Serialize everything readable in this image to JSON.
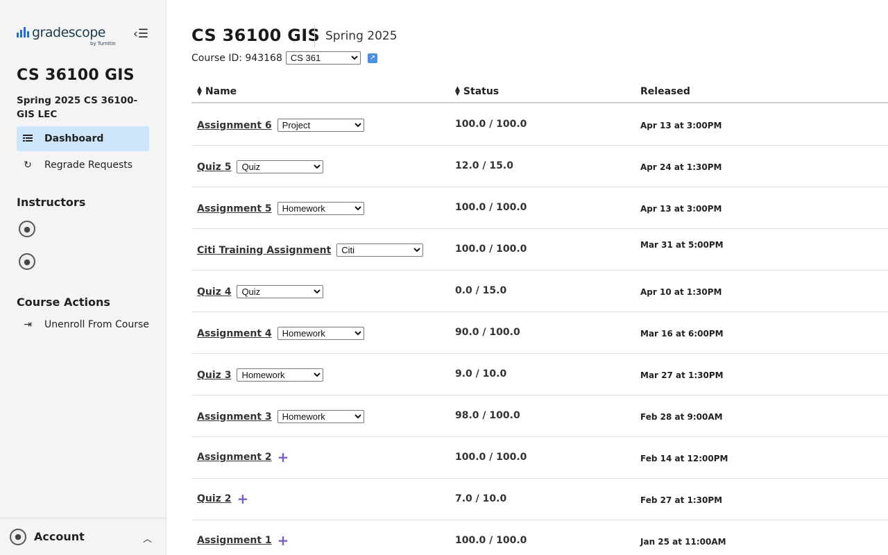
{
  "sidebar": {
    "logo_text": "gradescope",
    "logo_sub": "by Turnitin",
    "course_title": "CS 36100 GIS",
    "course_term": "Spring 2025 CS 36100-GIS LEC",
    "nav": [
      {
        "label": "Dashboard",
        "icon": "dashboard-icon",
        "active": true
      },
      {
        "label": "Regrade Requests",
        "icon": "refresh-icon",
        "active": false
      }
    ],
    "instructors_heading": "Instructors",
    "course_actions_heading": "Course Actions",
    "unenroll_label": "Unenroll From Course",
    "account_label": "Account"
  },
  "header": {
    "title": "CS 36100 GIS",
    "term": "Spring 2025",
    "course_id_label": "Course ID: 943168",
    "course_select_value": "CS 361"
  },
  "table": {
    "columns": [
      "Name",
      "Status",
      "Released"
    ],
    "rows": [
      {
        "name": "Assignment 6",
        "category": "Project",
        "status": "100.0 / 100.0",
        "released": "Apr 13 at 3:00PM"
      },
      {
        "name": "Quiz 5",
        "category": "Quiz",
        "status": "12.0 / 15.0",
        "released": "Apr 24 at 1:30PM"
      },
      {
        "name": "Assignment 5",
        "category": "Homework",
        "status": "100.0 / 100.0",
        "released": "Apr 13 at 3:00PM"
      },
      {
        "name": "Citi Training Assignment",
        "category": "Citi",
        "status": "100.0 / 100.0",
        "released": "Mar 31 at 5:00PM"
      },
      {
        "name": "Quiz 4",
        "category": "Quiz",
        "status": "0.0 / 15.0",
        "released": "Apr 10 at 1:30PM"
      },
      {
        "name": "Assignment 4",
        "category": "Homework",
        "status": "90.0 / 100.0",
        "released": "Mar 16 at 6:00PM"
      },
      {
        "name": "Quiz 3",
        "category": "Homework",
        "status": "9.0 / 10.0",
        "released": "Mar 27 at 1:30PM"
      },
      {
        "name": "Assignment 3",
        "category": "Homework",
        "status": "98.0 / 100.0",
        "released": "Feb 28 at 9:00AM"
      },
      {
        "name": "Assignment 2",
        "category": null,
        "status": "100.0 / 100.0",
        "released": "Feb 14 at 12:00PM"
      },
      {
        "name": "Quiz 2",
        "category": null,
        "status": "7.0 / 10.0",
        "released": "Feb 27 at 1:30PM"
      },
      {
        "name": "Assignment 1",
        "category": null,
        "status": "100.0 / 100.0",
        "released": "Jan 25 at 11:00AM"
      }
    ]
  },
  "colors": {
    "accent_blue": "#1f6fd6",
    "active_nav_bg": "#cde6fb",
    "plus_purple": "#7a5cc2"
  }
}
